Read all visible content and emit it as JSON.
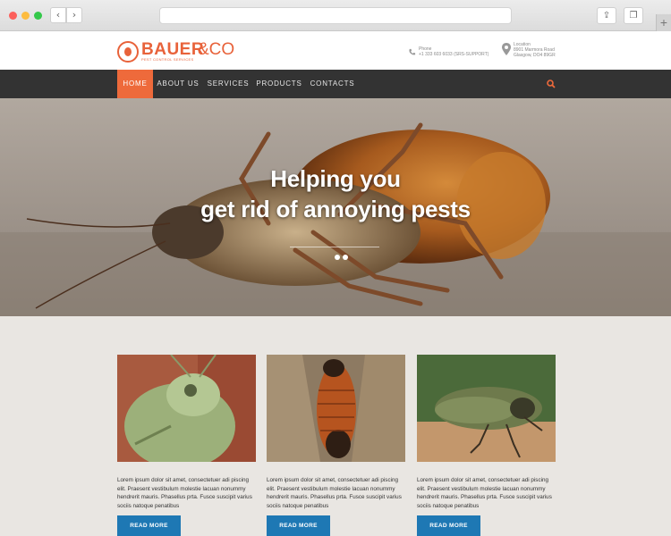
{
  "browser": {
    "back_glyph": "‹",
    "forward_glyph": "›",
    "share_glyph": "⇪",
    "tabs_glyph": "❐",
    "newtab_glyph": "+"
  },
  "brand": {
    "name": "BAUER",
    "suffix": "&CO",
    "tagline": "PEST CONTROL SERVICES",
    "accent_color": "#e8623a"
  },
  "contact": {
    "phone_label": "Phone",
    "phone_value": "+1 333 603 6033 (SRS-SUPPORT)",
    "location_label": "Location",
    "location_line1": "8901 Marmora Road",
    "location_line2": "Glasgow, DO4 89GR"
  },
  "nav": {
    "items": [
      {
        "label": "HOME",
        "active": true
      },
      {
        "label": "ABOUT US",
        "active": false
      },
      {
        "label": "SERVICES",
        "active": false
      },
      {
        "label": "PRODUCTS",
        "active": false
      },
      {
        "label": "CONTACTS",
        "active": false
      }
    ],
    "search_icon": "search-icon",
    "bar_color": "#333333",
    "active_color": "#ee6a3b"
  },
  "hero": {
    "title_line1": "Helping you",
    "title_line2": "get rid of annoying pests",
    "slides": 2,
    "active_slide": 1
  },
  "cards": [
    {
      "text": "Lorem ipsum dolor sit amet, consectetuer adi piscing elit. Praesent vestibulum molestie lacuan nonummy hendrerit mauris. Phasellus prta. Fusce suscipit varius sociis natoque penatibus",
      "button": "READ MORE"
    },
    {
      "text": "Lorem ipsum dolor sit amet, consectetuer adi piscing elit. Praesent vestibulum molestie lacuan nonummy hendrerit mauris. Phasellus prta. Fusce suscipit varius sociis natoque penatibus",
      "button": "READ MORE"
    },
    {
      "text": "Lorem ipsum dolor sit amet, consectetuer adi piscing elit. Praesent vestibulum molestie lacuan nonummy hendrerit mauris. Phasellus prta. Fusce suscipit varius sociis natoque penatibus",
      "button": "READ MORE"
    }
  ],
  "button_color": "#1e78b4"
}
